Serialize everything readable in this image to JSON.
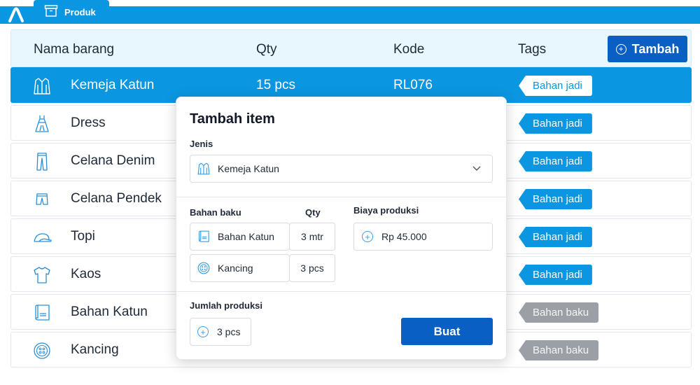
{
  "app": {
    "tab_label": "Produk"
  },
  "table": {
    "columns": [
      "Nama barang",
      "Qty",
      "Kode",
      "Tags"
    ],
    "add_button": "Tambah",
    "rows": [
      {
        "icon": "shirt-icon",
        "name": "Kemeja Katun",
        "qty": "15 pcs",
        "kode": "RL076",
        "tag": "Bahan jadi",
        "tag_type": "jadi",
        "selected": true
      },
      {
        "icon": "dress-icon",
        "name": "Dress",
        "qty": "",
        "kode": "",
        "tag": "Bahan jadi",
        "tag_type": "jadi",
        "selected": false
      },
      {
        "icon": "jeans-icon",
        "name": "Celana Denim",
        "qty": "",
        "kode": "",
        "tag": "Bahan jadi",
        "tag_type": "jadi",
        "selected": false
      },
      {
        "icon": "shorts-icon",
        "name": "Celana Pendek",
        "qty": "",
        "kode": "",
        "tag": "Bahan jadi",
        "tag_type": "jadi",
        "selected": false
      },
      {
        "icon": "cap-icon",
        "name": "Topi",
        "qty": "",
        "kode": "",
        "tag": "Bahan jadi",
        "tag_type": "jadi",
        "selected": false
      },
      {
        "icon": "tshirt-icon",
        "name": "Kaos",
        "qty": "",
        "kode": "",
        "tag": "Bahan jadi",
        "tag_type": "jadi",
        "selected": false
      },
      {
        "icon": "fabric-roll-icon",
        "name": "Bahan Katun",
        "qty": "",
        "kode": "",
        "tag": "Bahan baku",
        "tag_type": "baku",
        "selected": false
      },
      {
        "icon": "button-icon",
        "name": "Kancing",
        "qty": "",
        "kode": "",
        "tag": "Bahan baku",
        "tag_type": "baku",
        "selected": false
      }
    ]
  },
  "modal": {
    "title": "Tambah item",
    "jenis_label": "Jenis",
    "jenis_value": "Kemeja Katun",
    "bahan_label": "Bahan baku",
    "qty_label": "Qty",
    "biaya_label": "Biaya produksi",
    "bahan": [
      {
        "name": "Bahan Katun",
        "qty": "3 mtr"
      },
      {
        "name": "Kancing",
        "qty": "3 pcs"
      }
    ],
    "biaya_value": "Rp 45.000",
    "jumlah_label": "Jumlah produksi",
    "jumlah_value": "3 pcs",
    "submit_label": "Buat"
  },
  "colors": {
    "accent": "#0a96e0",
    "primary_button": "#0a5fc4",
    "tag_grey": "#9aa0a6"
  }
}
